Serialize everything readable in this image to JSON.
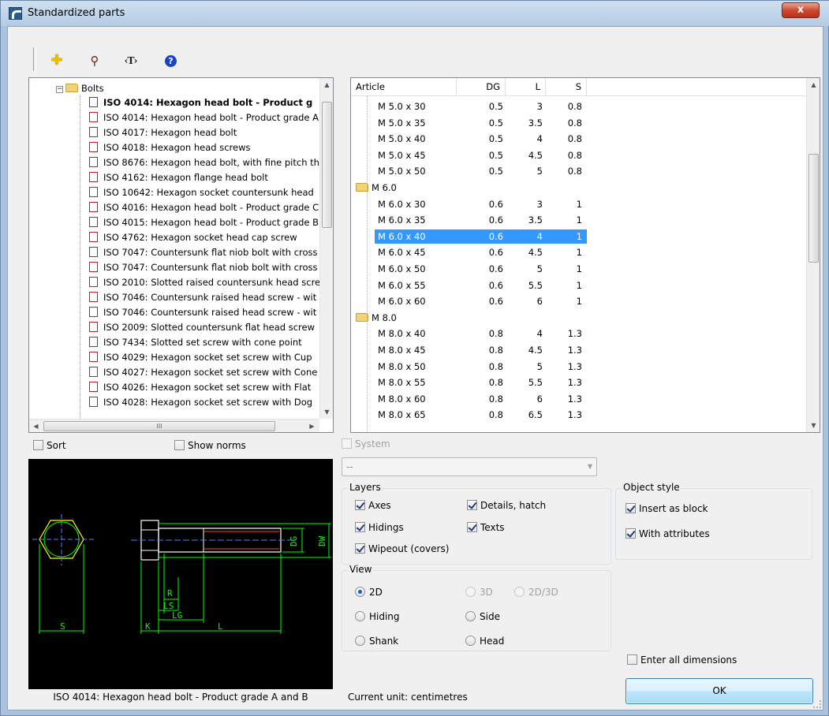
{
  "window": {
    "title": "Standardized parts",
    "close_label": "x"
  },
  "toolbar": {
    "text_tool_label": "‹T›",
    "help_label": "?"
  },
  "tree": {
    "folder": "Bolts",
    "items": [
      "ISO 4014: Hexagon head bolt - Product g",
      "ISO 4014: Hexagon head bolt - Product grade A",
      "ISO 4017: Hexagon head bolt",
      "ISO 4018: Hexagon head screws",
      "ISO 8676: Hexagon head bolt, with fine pitch th",
      "ISO 4162: Hexagon flange head bolt",
      "ISO 10642: Hexagon socket countersunk head",
      "ISO 4016: Hexagon head bolt - Product grade C",
      "ISO 4015: Hexagon head bolt - Product grade B",
      "ISO 4762: Hexagon socket head cap screw",
      "ISO 7047: Countersunk flat niob bolt with cross",
      "ISO 7047: Countersunk flat niob bolt with cross",
      "ISO 2010: Slotted raised countersunk head scre",
      "ISO 7046: Countersunk raised head screw - wit",
      "ISO 7046: Countersunk raised head screw - wit",
      "ISO 2009: Slotted countersunk flat head screw",
      "ISO 7434: Slotted set screw with cone point",
      "ISO 4029: Hexagon socket set screw with Cup",
      "ISO 4027: Hexagon socket set screw with Cone",
      "ISO 4026: Hexagon socket set screw with Flat",
      "ISO 4028: Hexagon socket set screw with Dog"
    ],
    "hscroll_mark": "III"
  },
  "grid": {
    "columns": [
      "Article",
      "DG",
      "L",
      "S"
    ],
    "rows": [
      {
        "type": "row",
        "article": "M 5.0 x 30",
        "dg": "0.5",
        "l": "3",
        "s": "0.8"
      },
      {
        "type": "row",
        "article": "M 5.0 x 35",
        "dg": "0.5",
        "l": "3.5",
        "s": "0.8"
      },
      {
        "type": "row",
        "article": "M 5.0 x 40",
        "dg": "0.5",
        "l": "4",
        "s": "0.8"
      },
      {
        "type": "row",
        "article": "M 5.0 x 45",
        "dg": "0.5",
        "l": "4.5",
        "s": "0.8"
      },
      {
        "type": "row",
        "article": "M 5.0 x 50",
        "dg": "0.5",
        "l": "5",
        "s": "0.8"
      },
      {
        "type": "group",
        "article": "M 6.0"
      },
      {
        "type": "row",
        "article": "M 6.0 x 30",
        "dg": "0.6",
        "l": "3",
        "s": "1"
      },
      {
        "type": "row",
        "article": "M 6.0 x 35",
        "dg": "0.6",
        "l": "3.5",
        "s": "1"
      },
      {
        "type": "row",
        "article": "M 6.0 x 40",
        "dg": "0.6",
        "l": "4",
        "s": "1",
        "selected": true
      },
      {
        "type": "row",
        "article": "M 6.0 x 45",
        "dg": "0.6",
        "l": "4.5",
        "s": "1"
      },
      {
        "type": "row",
        "article": "M 6.0 x 50",
        "dg": "0.6",
        "l": "5",
        "s": "1"
      },
      {
        "type": "row",
        "article": "M 6.0 x 55",
        "dg": "0.6",
        "l": "5.5",
        "s": "1"
      },
      {
        "type": "row",
        "article": "M 6.0 x 60",
        "dg": "0.6",
        "l": "6",
        "s": "1"
      },
      {
        "type": "group",
        "article": "M 8.0"
      },
      {
        "type": "row",
        "article": "M 8.0 x 40",
        "dg": "0.8",
        "l": "4",
        "s": "1.3"
      },
      {
        "type": "row",
        "article": "M 8.0 x 45",
        "dg": "0.8",
        "l": "4.5",
        "s": "1.3"
      },
      {
        "type": "row",
        "article": "M 8.0 x 50",
        "dg": "0.8",
        "l": "5",
        "s": "1.3"
      },
      {
        "type": "row",
        "article": "M 8.0 x 55",
        "dg": "0.8",
        "l": "5.5",
        "s": "1.3"
      },
      {
        "type": "row",
        "article": "M 8.0 x 60",
        "dg": "0.8",
        "l": "6",
        "s": "1.3"
      },
      {
        "type": "row",
        "article": "M 8.0 x 65",
        "dg": "0.8",
        "l": "6.5",
        "s": "1.3"
      }
    ]
  },
  "options": {
    "sort": {
      "label": "Sort",
      "checked": false
    },
    "show_norms": {
      "label": "Show norms",
      "checked": false
    },
    "system": {
      "label": "System",
      "checked": false,
      "disabled": true
    },
    "system_combo_value": "--"
  },
  "layers": {
    "title": "Layers",
    "axes": {
      "label": "Axes",
      "checked": true
    },
    "details_hatch": {
      "label": "Details, hatch",
      "checked": true
    },
    "hidings": {
      "label": "Hidings",
      "checked": true
    },
    "texts": {
      "label": "Texts",
      "checked": true
    },
    "wipeout": {
      "label": "Wipeout (covers)",
      "checked": true
    }
  },
  "view": {
    "title": "View",
    "options": {
      "2d": {
        "label": "2D",
        "selected": true,
        "disabled": false
      },
      "3d": {
        "label": "3D",
        "selected": false,
        "disabled": true
      },
      "2d3d": {
        "label": "2D/3D",
        "selected": false,
        "disabled": true
      },
      "hiding": {
        "label": "Hiding",
        "selected": false,
        "disabled": false
      },
      "side": {
        "label": "Side",
        "selected": false,
        "disabled": false
      },
      "shank": {
        "label": "Shank",
        "selected": false,
        "disabled": false
      },
      "head": {
        "label": "Head",
        "selected": false,
        "disabled": false
      }
    }
  },
  "object_style": {
    "title": "Object style",
    "insert_as_block": {
      "label": "Insert as block",
      "checked": true
    },
    "with_attributes": {
      "label": "With attributes",
      "checked": true
    }
  },
  "enter_all_dimensions": {
    "label": "Enter all dimensions",
    "checked": false
  },
  "preview": {
    "caption": "ISO 4014: Hexagon head bolt - Product grade A and B",
    "labels": {
      "s": "S",
      "k": "K",
      "l": "L",
      "lg": "LG",
      "ls": "LS",
      "r": "R",
      "dg": "DG",
      "dw": "DW"
    },
    "colors": {
      "background": "#000000",
      "outline": "#ffffff",
      "dimension": "#00ff00",
      "axis": "#5a7cff",
      "hex": "#ffff00"
    }
  },
  "status": {
    "current_unit": "Current unit: centimetres"
  },
  "ok_label": "OK"
}
